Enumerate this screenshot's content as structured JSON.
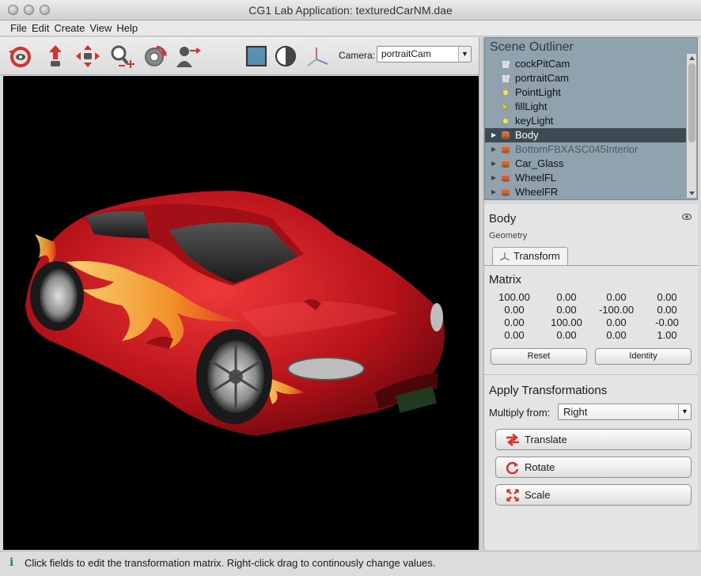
{
  "window": {
    "title": "CG1 Lab Application: texturedCarNM.dae"
  },
  "menu": [
    "File",
    "Edit",
    "Create",
    "View",
    "Help"
  ],
  "toolbar": {
    "camera_label": "Camera:",
    "camera_value": "portraitCam",
    "icons": [
      "orbit-icon",
      "dolly-icon",
      "pan-icon",
      "zoom-icon",
      "rotate-view-icon",
      "walk-icon",
      "shade-solid-icon",
      "shade-contrast-icon",
      "axes-icon"
    ]
  },
  "outliner": {
    "title": "Scene Outliner",
    "items": [
      {
        "label": "cockPitCam",
        "icon": "camera-icon",
        "expandable": false,
        "selected": false,
        "dim": false
      },
      {
        "label": "portraitCam",
        "icon": "camera-icon",
        "expandable": false,
        "selected": false,
        "dim": false
      },
      {
        "label": "PointLight",
        "icon": "light-icon",
        "expandable": false,
        "selected": false,
        "dim": false
      },
      {
        "label": "fillLight",
        "icon": "spot-light-icon",
        "expandable": false,
        "selected": false,
        "dim": false
      },
      {
        "label": "keyLight",
        "icon": "light-icon",
        "expandable": false,
        "selected": false,
        "dim": false
      },
      {
        "label": "Body",
        "icon": "mesh-icon",
        "expandable": true,
        "selected": true,
        "dim": false
      },
      {
        "label": "BottomFBXASC045Interior",
        "icon": "mesh-icon",
        "expandable": true,
        "selected": false,
        "dim": true
      },
      {
        "label": "Car_Glass",
        "icon": "mesh-icon",
        "expandable": true,
        "selected": false,
        "dim": false
      },
      {
        "label": "WheelFL",
        "icon": "mesh-icon",
        "expandable": true,
        "selected": false,
        "dim": false
      },
      {
        "label": "WheelFR",
        "icon": "mesh-icon",
        "expandable": true,
        "selected": false,
        "dim": false
      }
    ]
  },
  "properties": {
    "node_name": "Body",
    "node_type": "Geometry",
    "tab_label": "Transform",
    "matrix_title": "Matrix",
    "matrix": [
      [
        "100.00",
        "0.00",
        "0.00",
        "0.00"
      ],
      [
        "0.00",
        "0.00",
        "-100.00",
        "0.00"
      ],
      [
        "0.00",
        "100.00",
        "0.00",
        "-0.00"
      ],
      [
        "0.00",
        "0.00",
        "0.00",
        "1.00"
      ]
    ],
    "reset_label": "Reset",
    "identity_label": "Identity",
    "apply_title": "Apply Transformations",
    "multiply_label": "Multiply from:",
    "multiply_value": "Right",
    "translate_label": "Translate",
    "rotate_label": "Rotate",
    "scale_label": "Scale"
  },
  "status": {
    "message": "Click fields to edit the transformation matrix. Right-click drag to continously change values."
  },
  "colors": {
    "outliner_bg": "#8fa2ad",
    "selection": "#3d4a52",
    "car_red": "#c8141c",
    "accent_red": "#d4322a"
  }
}
